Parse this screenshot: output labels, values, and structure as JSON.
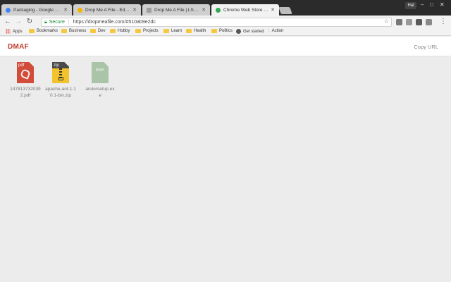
{
  "tabs": [
    {
      "title": "Packaging - Google Chr",
      "favicon_color": "#4285f4",
      "state": "inactive"
    },
    {
      "title": "Drop Me A File - Edit Ite",
      "favicon_color": "#f4b400",
      "state": "inactive"
    },
    {
      "title": "Drop Me A File | LSD Sof",
      "favicon_color": "#9e9e9e",
      "state": "inactive"
    },
    {
      "title": "Chrome Web Store - sc",
      "favicon_color": "#34a853",
      "state": "active"
    }
  ],
  "profile": {
    "name": "Hal"
  },
  "window_controls": {
    "minimize": "–",
    "maximize": "□",
    "close": "✕"
  },
  "toolbar": {
    "secure_label": "Secure",
    "url": "https://dropmeafile.com/#510ab9e2dc"
  },
  "bookmarks": [
    {
      "label": "Apps",
      "icon": "apps-icon"
    },
    {
      "label": "Bookmarks",
      "icon": "folder-icon"
    },
    {
      "label": "Business",
      "icon": "folder-icon"
    },
    {
      "label": "Dev",
      "icon": "folder-icon"
    },
    {
      "label": "Hobby",
      "icon": "folder-icon"
    },
    {
      "label": "Projects",
      "icon": "folder-icon"
    },
    {
      "label": "Learn",
      "icon": "folder-icon"
    },
    {
      "label": "Health",
      "icon": "folder-icon"
    },
    {
      "label": "Politics",
      "icon": "folder-icon"
    },
    {
      "label": "Get started",
      "icon": "globe-icon"
    },
    {
      "label": "Action",
      "icon": ""
    }
  ],
  "app": {
    "brand": "DMAF",
    "copy_url_label": "Copy URL",
    "brand_color": "#c0392b"
  },
  "files": [
    {
      "name": "1478137320392.pdf",
      "type": "pdf",
      "badge": "pdf",
      "color": "#d24c3a"
    },
    {
      "name": "apache-ant-1.10.1-bin.zip",
      "type": "zip",
      "badge": "zip",
      "color": "#f3c32d"
    },
    {
      "name": "arulersetup.exe",
      "type": "exe",
      "badge": "exe",
      "color": "#a9c4a7"
    }
  ]
}
